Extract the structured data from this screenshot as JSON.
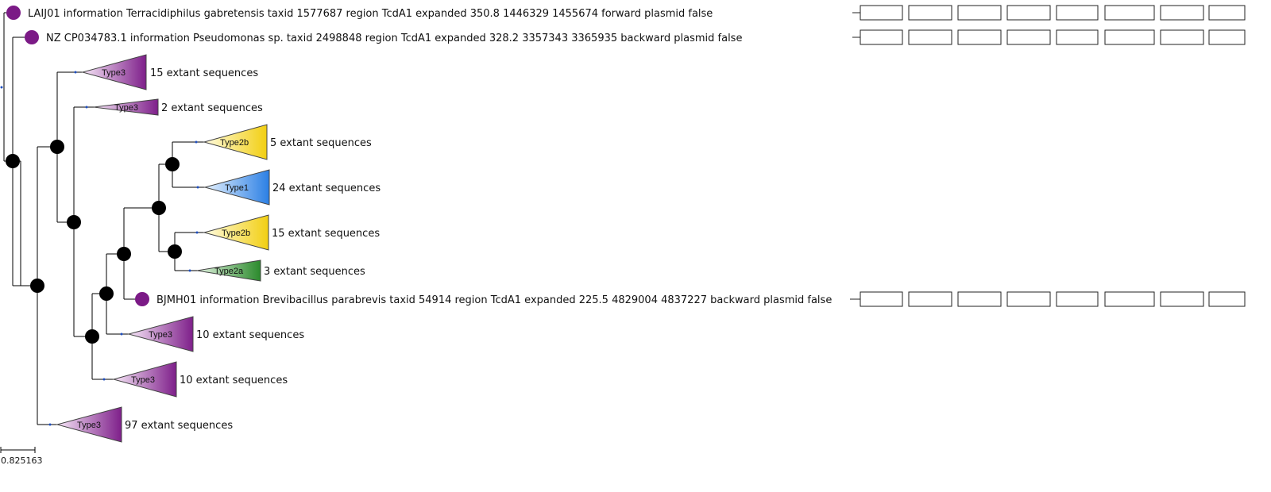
{
  "leaves": [
    {
      "label": "LAIJ01 information Terracidiphilus gabretensis taxid 1577687 region TcdA1 expanded  350.8  1446329 1455674 forward plasmid false",
      "color": "#7b1a86"
    },
    {
      "label": "NZ CP034783.1 information Pseudomonas sp. taxid 2498848 region TcdA1 expanded  328.2  3357343 3365935 backward plasmid false",
      "color": "#7b1a86"
    },
    {
      "label": "BJMH01 information Brevibacillus parabrevis taxid 54914 region TcdA1 expanded  225.5  4829004 4837227 backward plasmid false",
      "color": "#7b1a86"
    }
  ],
  "clades": [
    {
      "name": "Type3",
      "count_text": "15 extant sequences",
      "color": "#8a2c92"
    },
    {
      "name": "Type3",
      "count_text": "2 extant sequences",
      "color": "#8a2c92"
    },
    {
      "name": "Type2b",
      "count_text": "5 extant sequences",
      "color": "#f2d21b"
    },
    {
      "name": "Type1",
      "count_text": "24 extant sequences",
      "color": "#2f86e6"
    },
    {
      "name": "Type2b",
      "count_text": "15 extant sequences",
      "color": "#f2d21b"
    },
    {
      "name": "Type2a",
      "count_text": "3 extant sequences",
      "color": "#2e8a2e"
    },
    {
      "name": "Type3",
      "count_text": "10 extant sequences",
      "color": "#8a2c92"
    },
    {
      "name": "Type3",
      "count_text": "10 extant sequences",
      "color": "#8a2c92"
    },
    {
      "name": "Type3",
      "count_text": "97 extant sequences",
      "color": "#8a2c92"
    }
  ],
  "scale_bar": {
    "label": "0.825163"
  }
}
